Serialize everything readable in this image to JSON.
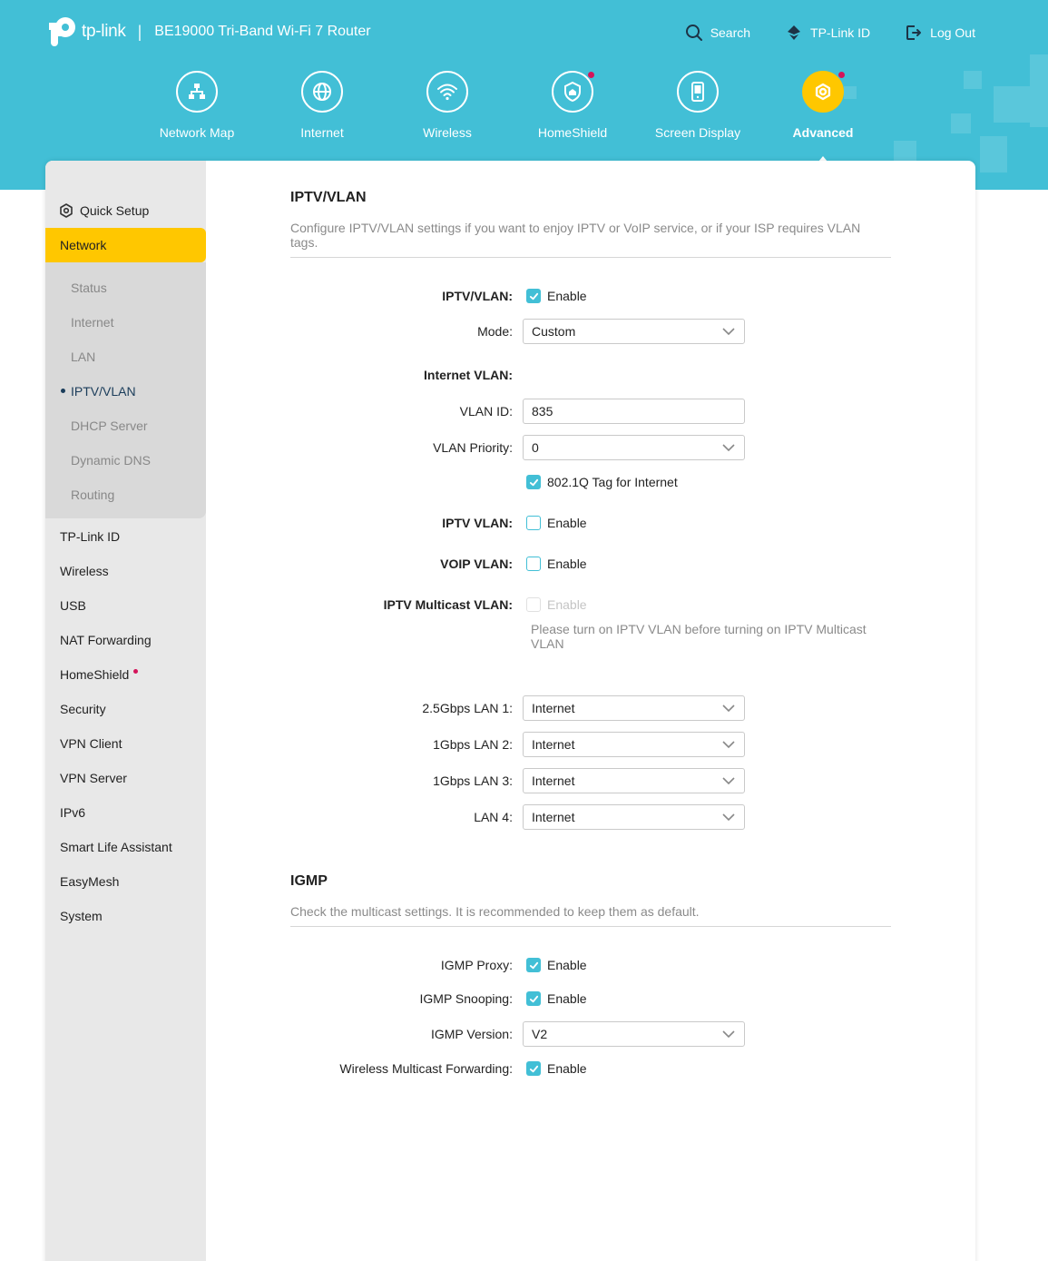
{
  "header": {
    "logo_text": "tp-link",
    "separator": "|",
    "model": "BE19000 Tri-Band Wi-Fi 7 Router",
    "links": {
      "search": "Search",
      "tplink_id": "TP-Link ID",
      "logout": "Log Out"
    }
  },
  "nav": {
    "items": [
      {
        "label": "Network Map",
        "icon": "network-map-icon"
      },
      {
        "label": "Internet",
        "icon": "globe-icon"
      },
      {
        "label": "Wireless",
        "icon": "wifi-icon"
      },
      {
        "label": "HomeShield",
        "icon": "homeshield-icon"
      },
      {
        "label": "Screen Display",
        "icon": "screen-icon"
      },
      {
        "label": "Advanced",
        "icon": "gear-icon"
      }
    ],
    "active": "Advanced"
  },
  "sidebar": {
    "quick_setup": "Quick Setup",
    "network": "Network",
    "network_sub": [
      "Status",
      "Internet",
      "LAN",
      "IPTV/VLAN",
      "DHCP Server",
      "Dynamic DNS",
      "Routing"
    ],
    "items": [
      "TP-Link ID",
      "Wireless",
      "USB",
      "NAT Forwarding",
      "HomeShield",
      "Security",
      "VPN Client",
      "VPN Server",
      "IPv6",
      "Smart Life Assistant",
      "EasyMesh",
      "System"
    ]
  },
  "iptv": {
    "title": "IPTV/VLAN",
    "desc": "Configure IPTV/VLAN settings if you want to enjoy IPTV or VoIP service, or if your ISP requires VLAN tags.",
    "iptv_vlan_label": "IPTV/VLAN:",
    "enable": "Enable",
    "mode_label": "Mode:",
    "mode_value": "Custom",
    "internet_vlan_label": "Internet VLAN:",
    "vlan_id_label": "VLAN ID:",
    "vlan_id_value": "835",
    "vlan_priority_label": "VLAN Priority:",
    "vlan_priority_value": "0",
    "tag_label": "802.1Q Tag for Internet",
    "iptv_label": "IPTV VLAN:",
    "voip_label": "VOIP VLAN:",
    "multicast_label": "IPTV Multicast VLAN:",
    "multicast_hint": "Please turn on IPTV VLAN before turning on IPTV Multicast VLAN",
    "ports": [
      {
        "label": "2.5Gbps LAN 1:",
        "value": "Internet"
      },
      {
        "label": "1Gbps LAN 2:",
        "value": "Internet"
      },
      {
        "label": "1Gbps LAN 3:",
        "value": "Internet"
      },
      {
        "label": "LAN 4:",
        "value": "Internet"
      }
    ]
  },
  "igmp": {
    "title": "IGMP",
    "desc": "Check the multicast settings. It is recommended to keep them as default.",
    "proxy_label": "IGMP Proxy:",
    "snooping_label": "IGMP Snooping:",
    "version_label": "IGMP Version:",
    "version_value": "V2",
    "wireless_label": "Wireless Multicast Forwarding:",
    "enable": "Enable"
  },
  "colors": {
    "header": "#42bfd6",
    "accent": "#ffc700",
    "check": "#42bfd6",
    "dot": "#d4145a"
  }
}
